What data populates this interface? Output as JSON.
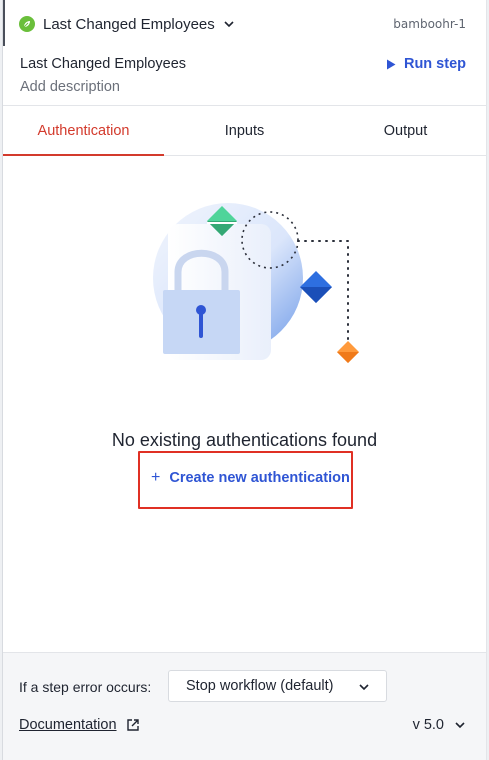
{
  "header": {
    "step_title": "Last Changed Employees",
    "app_key": "bamboohr-1",
    "app_icon": "bamboohr-leaf-icon",
    "app_color": "#6abf3b"
  },
  "step": {
    "name": "Last Changed Employees",
    "run_label": "Run step",
    "description_placeholder": "Add description"
  },
  "tabs": [
    {
      "label": "Authentication",
      "active": true
    },
    {
      "label": "Inputs",
      "active": false
    },
    {
      "label": "Output",
      "active": false
    }
  ],
  "empty_state": {
    "message": "No existing authentications found",
    "create_label": "Create new authentication",
    "illustration": "padlock-illustration"
  },
  "footer": {
    "error_label": "If a step error occurs:",
    "error_option": "Stop workflow (default)",
    "documentation_label": "Documentation",
    "version_label": "v 5.0"
  },
  "colors": {
    "accent_red": "#d33a2c",
    "link_blue": "#2f55d4"
  }
}
